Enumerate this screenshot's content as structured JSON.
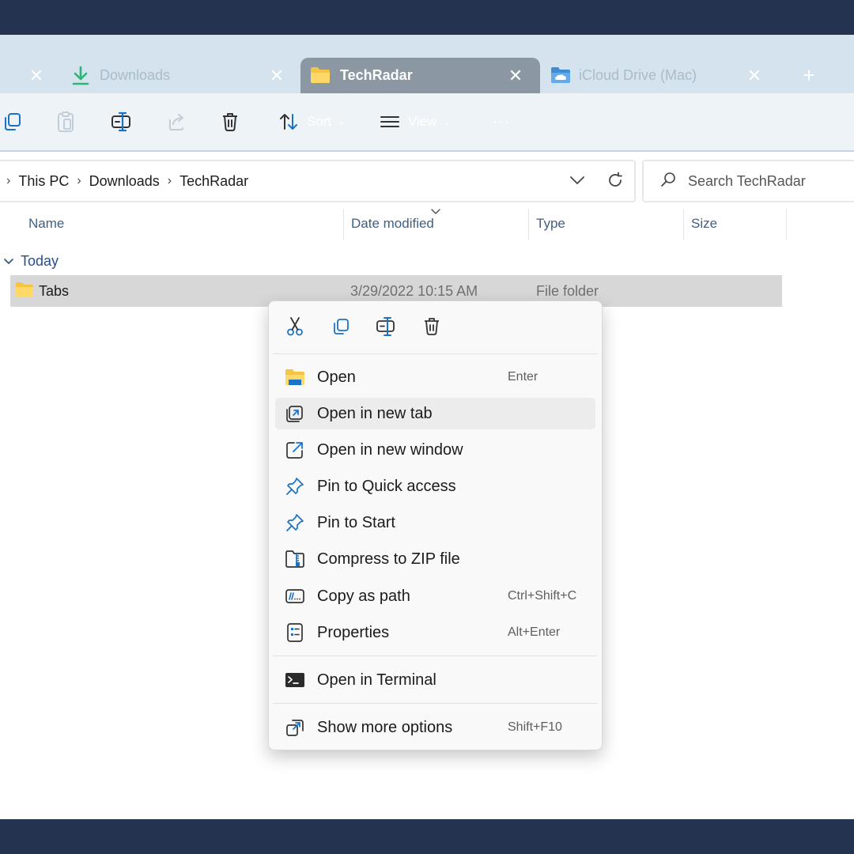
{
  "tabs": [
    {
      "label": "Downloads",
      "icon": "download-icon"
    },
    {
      "label": "TechRadar",
      "icon": "folder-icon",
      "active": true
    },
    {
      "label": "iCloud Drive (Mac)",
      "icon": "icloud-folder-icon"
    }
  ],
  "tab_close_glyph": "✕",
  "new_tab_glyph": "+",
  "toolbar": {
    "sort_label": "Sort",
    "view_label": "View",
    "more_label": "···",
    "chevron": "⌄"
  },
  "breadcrumb": [
    "This PC",
    "Downloads",
    "TechRadar"
  ],
  "breadcrumb_sep": "›",
  "search": {
    "placeholder": "Search TechRadar"
  },
  "columns": [
    "Name",
    "Date modified",
    "Type",
    "Size"
  ],
  "group": {
    "label": "Today"
  },
  "files": [
    {
      "name": "Tabs",
      "date_modified": "3/29/2022 10:15 AM",
      "type": "File folder",
      "size": ""
    }
  ],
  "context_menu": {
    "quick_actions": [
      "cut-icon",
      "copy-icon",
      "rename-icon",
      "delete-icon"
    ],
    "items": [
      {
        "label": "Open",
        "shortcut": "Enter",
        "icon": "folder-open-icon"
      },
      {
        "label": "Open in new tab",
        "shortcut": "",
        "icon": "new-tab-icon",
        "hovered": true
      },
      {
        "label": "Open in new window",
        "shortcut": "",
        "icon": "new-window-icon"
      },
      {
        "label": "Pin to Quick access",
        "shortcut": "",
        "icon": "pin-icon"
      },
      {
        "label": "Pin to Start",
        "shortcut": "",
        "icon": "pin-icon"
      },
      {
        "label": "Compress to ZIP file",
        "shortcut": "",
        "icon": "zip-icon"
      },
      {
        "label": "Copy as path",
        "shortcut": "Ctrl+Shift+C",
        "icon": "copy-path-icon"
      },
      {
        "label": "Properties",
        "shortcut": "Alt+Enter",
        "icon": "properties-icon"
      },
      {
        "label": "Open in Terminal",
        "shortcut": "",
        "icon": "terminal-icon"
      },
      {
        "label": "Show more options",
        "shortcut": "Shift+F10",
        "icon": "more-options-icon"
      }
    ]
  },
  "colors": {
    "frame": "#233350",
    "tabstrip": "#d5e3ee",
    "active_tab": "#8b97a3",
    "accent_blue": "#1a73c7",
    "selected_row": "#d7d7d7"
  }
}
